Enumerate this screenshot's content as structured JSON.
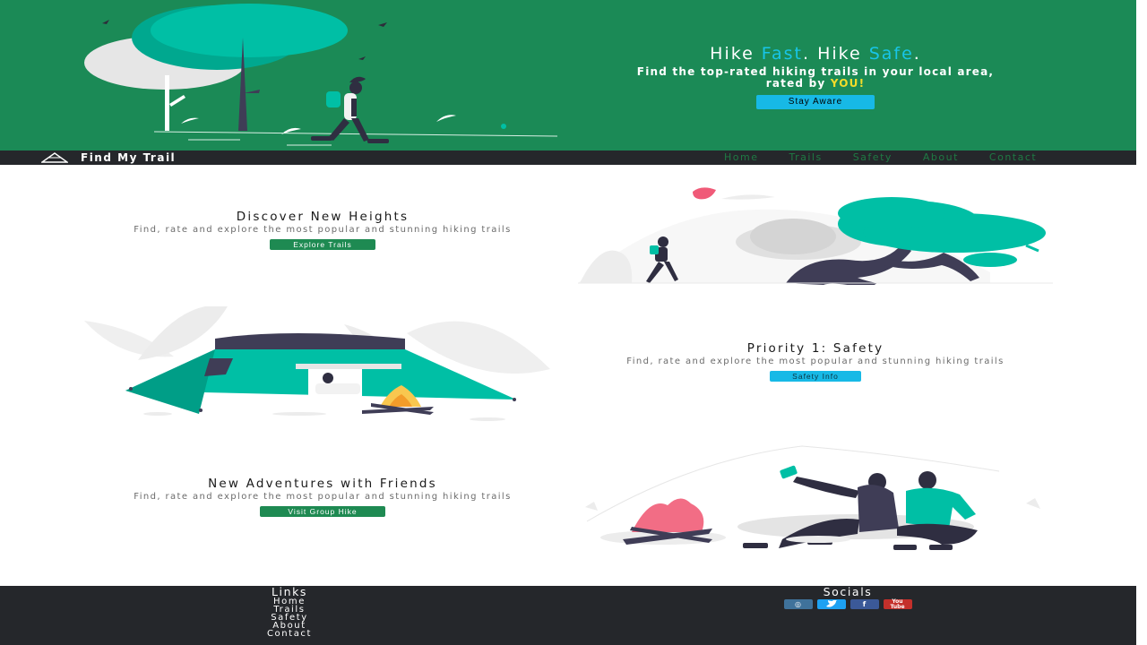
{
  "hero": {
    "title_part1": "Hike ",
    "title_fast": "Fast",
    "title_part2": ". Hike ",
    "title_safe": "Safe",
    "title_part3": ".",
    "subtitle_line1": "Find the top-rated hiking trails in your local area,",
    "subtitle_line2_prefix": "rated by ",
    "subtitle_highlight": "YOU!",
    "button_label": "Stay Aware"
  },
  "nav": {
    "brand": "Find My Trail",
    "links": [
      "Home",
      "Trails",
      "Safety",
      "About",
      "Contact"
    ]
  },
  "sections": [
    {
      "title": "Discover New Heights",
      "description": "Find, rate and explore the most popular and stunning hiking trails",
      "button_label": "Explore Trails"
    },
    {
      "title": "Priority 1: Safety",
      "description": "Find, rate and explore the most popular and stunning hiking trails",
      "button_label": "Safety Info"
    },
    {
      "title": "New Adventures with Friends",
      "description": "Find, rate and explore the most popular and stunning hiking trails",
      "button_label": "Visit Group Hike"
    }
  ],
  "footer": {
    "links_heading": "Links",
    "links": [
      "Home",
      "Trails",
      "Safety",
      "About",
      "Contact"
    ],
    "socials_heading": "Socials",
    "socials": [
      {
        "icon": "instagram-icon",
        "glyph": "◎",
        "color": "#3f729b"
      },
      {
        "icon": "twitter-icon",
        "glyph": "🐦",
        "color": "#1da1f2"
      },
      {
        "icon": "facebook-icon",
        "glyph": "f",
        "color": "#3b5998"
      },
      {
        "icon": "youtube-icon",
        "glyph": "You Tube",
        "color": "#c4302b"
      }
    ]
  },
  "colors": {
    "hero_bg": "#1b8a56",
    "nav_bg": "#25272b",
    "accent_cyan": "#18c5e8",
    "accent_yellow": "#f2dc2a",
    "button_green": "#1e8a52",
    "illustration_teal": "#00b89c"
  }
}
